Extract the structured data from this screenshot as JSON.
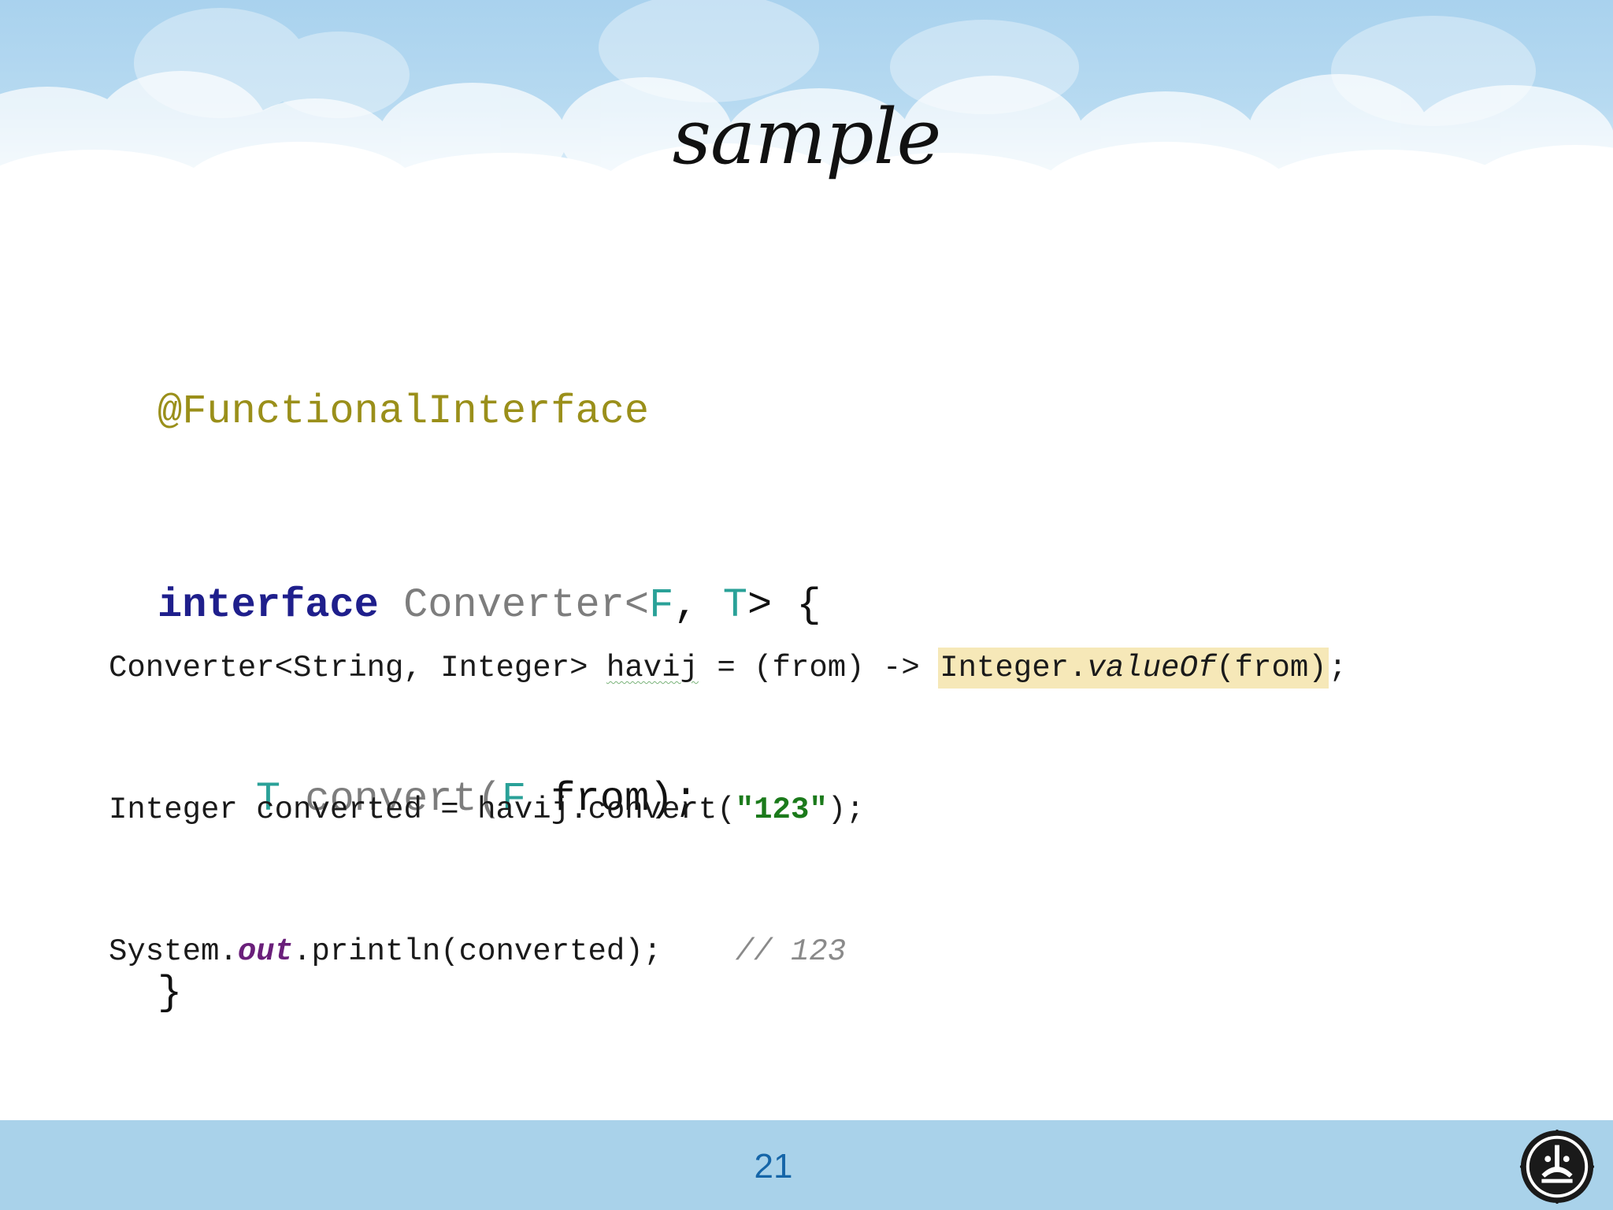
{
  "slide": {
    "title": "sample",
    "page_number": "21"
  },
  "code_block_1": {
    "annotation": "@FunctionalInterface",
    "line2_keyword": "interface",
    "line2_name": "Converter<",
    "line2_tp1": "F",
    "line2_comma": ", ",
    "line2_tp2": "T",
    "line2_tail": "> {",
    "line3_indent": "    ",
    "line3_type": "T",
    "line3_method": " convert(",
    "line3_param_type": "F",
    "line3_rest": " from);",
    "line4": "}"
  },
  "code_block_2": {
    "l1_a": "Converter<String, Integer> ",
    "l1_var": "havij",
    "l1_b": " = (from) -> ",
    "l1_hl_a": "Integer.",
    "l1_hl_method": "valueOf",
    "l1_hl_b": "(from)",
    "l1_end": ";",
    "l2_a": "Integer converted = havij.convert(",
    "l2_str": "\"123\"",
    "l2_end": ");",
    "l3_a": "System.",
    "l3_field": "out",
    "l3_b": ".println(converted);    ",
    "l3_comment": "// 123"
  },
  "colors": {
    "sky": "#a9d2ee",
    "footer": "#a9d2ea",
    "page_number": "#1565a8",
    "annotation": "#9a8f1a",
    "keyword": "#1f1f8c",
    "type_param": "#2aa198",
    "string": "#1b7a1b",
    "highlight": "#f6e8b8"
  },
  "icons": {
    "logo": "university-emblem-icon"
  }
}
